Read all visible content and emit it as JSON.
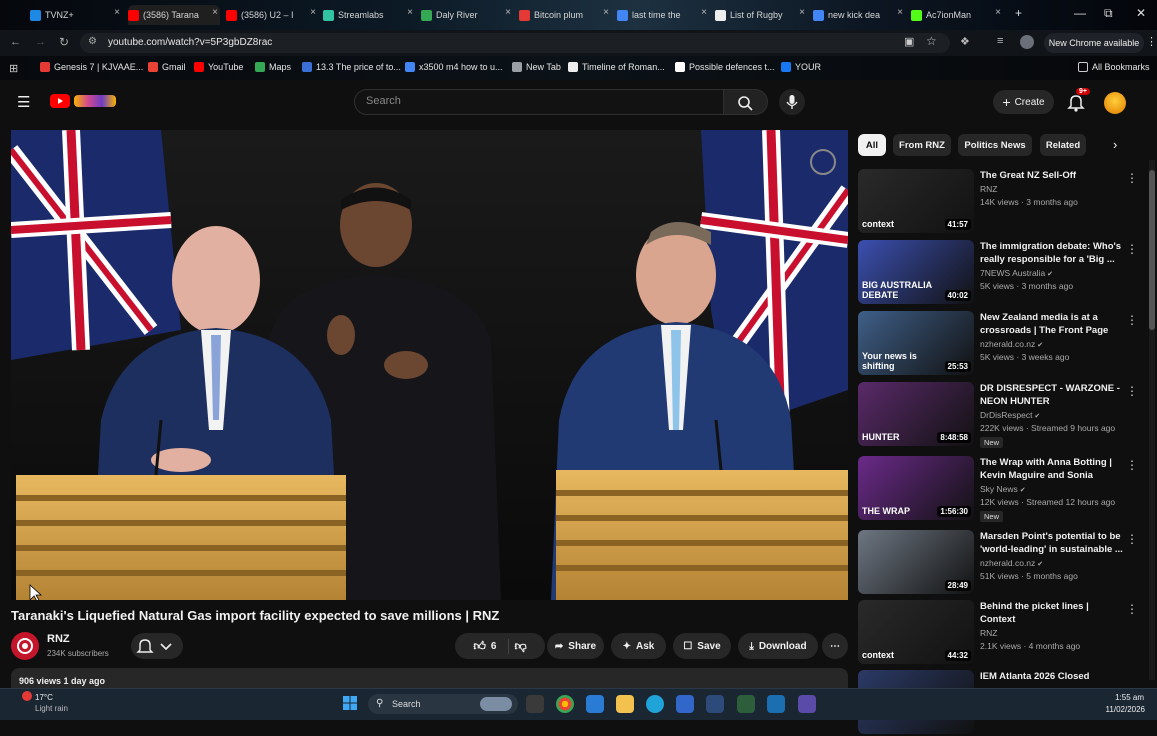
{
  "browser": {
    "tabs": [
      {
        "label": "TVNZ+",
        "color": "#1e88e5"
      },
      {
        "label": "(3586) Tarana",
        "color": "#ff0000"
      },
      {
        "label": "(3586) U2 – I",
        "color": "#ff0000"
      },
      {
        "label": "Streamlabs",
        "color": "#31c3a2"
      },
      {
        "label": "Daly River",
        "color": "#34a853"
      },
      {
        "label": "Bitcoin plum",
        "color": "#e53935"
      },
      {
        "label": "last time the",
        "color": "#4285f4"
      },
      {
        "label": "List of Rugby",
        "color": "#eeeeee"
      },
      {
        "label": "new kick dea",
        "color": "#4285f4"
      },
      {
        "label": "Ac7ionMan",
        "color": "#53fc18"
      }
    ],
    "url": "youtube.com/watch?v=5P3gbDZ8rac",
    "update_label": "New Chrome available",
    "bookmarks": [
      {
        "label": "Genesis 7 | KJVAAE...",
        "color": "#e53935"
      },
      {
        "label": "Gmail",
        "color": "#ea4335"
      },
      {
        "label": "YouTube",
        "color": "#ff0000"
      },
      {
        "label": "Maps",
        "color": "#34a853"
      },
      {
        "label": "13.3 The price of to...",
        "color": "#3b6fd8"
      },
      {
        "label": "x3500 m4 how to u...",
        "color": "#4285f4"
      },
      {
        "label": "New Tab",
        "color": "#9aa0a6"
      },
      {
        "label": "Timeline of Roman...",
        "color": "#eeeeee"
      },
      {
        "label": "Possible defences t...",
        "color": "#ffffff"
      },
      {
        "label": "YOUR",
        "color": "#1877f2"
      }
    ],
    "all_bookmarks": "All Bookmarks"
  },
  "youtube": {
    "search_placeholder": "Search",
    "create_label": "Create",
    "notif_badge": "9+",
    "video": {
      "title": "Taranaki's Liquefied Natural Gas import facility expected to save millions | RNZ",
      "channel": "RNZ",
      "subscribers": "234K subscribers",
      "likes": "6",
      "share": "Share",
      "ask": "Ask",
      "save": "Save",
      "download": "Download",
      "views_line": "906 views  1 day ago"
    },
    "chips": [
      "All",
      "From RNZ",
      "Politics News",
      "Related"
    ],
    "recommendations": [
      {
        "title": "The Great NZ Sell-Off",
        "channel": "RNZ",
        "meta": "14K views · 3 months ago",
        "duration": "41:57",
        "thumb_label": "context",
        "thumb_color": "#2a2a2a",
        "verified": false,
        "new": false
      },
      {
        "title": "The immigration debate: Who's really responsible for a 'Big ...",
        "channel": "7NEWS Australia",
        "meta": "5K views · 3 months ago",
        "duration": "40:02",
        "thumb_label": "BIG AUSTRALIA DEBATE",
        "thumb_color": "#3b4fb0",
        "verified": true,
        "new": false
      },
      {
        "title": "New Zealand media is at a crossroads | The Front Page",
        "channel": "nzherald.co.nz",
        "meta": "5K views · 3 weeks ago",
        "duration": "25:53",
        "thumb_label": "Your news is shifting",
        "thumb_color": "#3f5f88",
        "verified": true,
        "new": false
      },
      {
        "title": "DR DISRESPECT - WARZONE - NEON HUNTER",
        "channel": "DrDisRespect",
        "meta": "222K views · Streamed 9 hours ago",
        "duration": "8:48:58",
        "thumb_label": "HUNTER",
        "thumb_color": "#5a2a6a",
        "verified": true,
        "new": true
      },
      {
        "title": "The Wrap with Anna Botting | Kevin Maguire and Sonia Sodh...",
        "channel": "Sky News",
        "meta": "12K views · Streamed 12 hours ago",
        "duration": "1:56:30",
        "thumb_label": "THE WRAP",
        "thumb_color": "#6b2a8a",
        "verified": true,
        "new": true
      },
      {
        "title": "Marsden Point's potential to be 'world-leading' in sustainable ...",
        "channel": "nzherald.co.nz",
        "meta": "51K views · 5 months ago",
        "duration": "28:49",
        "thumb_label": "",
        "thumb_color": "#6d7682",
        "verified": true,
        "new": false
      },
      {
        "title": "Behind the picket lines | Context",
        "channel": "RNZ",
        "meta": "2.1K views · 4 months ago",
        "duration": "44:32",
        "thumb_label": "context",
        "thumb_color": "#2a2a2a",
        "verified": false,
        "new": false
      },
      {
        "title": "IEM Atlanta 2026 Closed",
        "channel": "",
        "meta": "",
        "duration": "",
        "thumb_label": "",
        "thumb_color": "#2b3a66",
        "verified": false,
        "new": false
      }
    ],
    "new_badge": "New"
  },
  "taskbar": {
    "weather_temp": "17°C",
    "weather_desc": "Light rain",
    "search": "Search",
    "time": "1:55 am",
    "date": "11/02/2026"
  }
}
